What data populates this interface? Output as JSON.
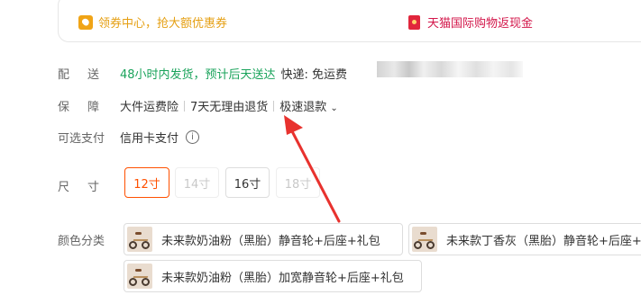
{
  "promo": {
    "coupon_text": "领券中心，抢大额优惠券",
    "tmall_text": "天猫国际购物返现金"
  },
  "shipping": {
    "label": "配送",
    "value_green": "48小时内发货，预计后天送达",
    "value_dark": "快递: 免运费"
  },
  "guarantee": {
    "label": "保障",
    "items": [
      "大件运费险",
      "7天无理由退货",
      "极速退款"
    ]
  },
  "payment": {
    "label": "可选支付",
    "value": "信用卡支付"
  },
  "size": {
    "label": "尺寸",
    "options": [
      {
        "label": "12寸",
        "state": "selected"
      },
      {
        "label": "14寸",
        "state": "disabled"
      },
      {
        "label": "16寸",
        "state": "available"
      },
      {
        "label": "18寸",
        "state": "disabled"
      }
    ]
  },
  "color": {
    "label": "颜色分类",
    "options": [
      "未来款奶油粉（黑胎）静音轮+后座+礼包",
      "未来款丁香灰（黑胎）静音轮+后座+礼包",
      "未来款奶油粉（黑胎）加宽静音轮+后座+礼包"
    ]
  },
  "colors": {
    "accent": "#ff5000",
    "green": "#1aa35b",
    "coupon": "#e59f12",
    "tmall": "#d3164a",
    "arrow": "#e8322e"
  }
}
